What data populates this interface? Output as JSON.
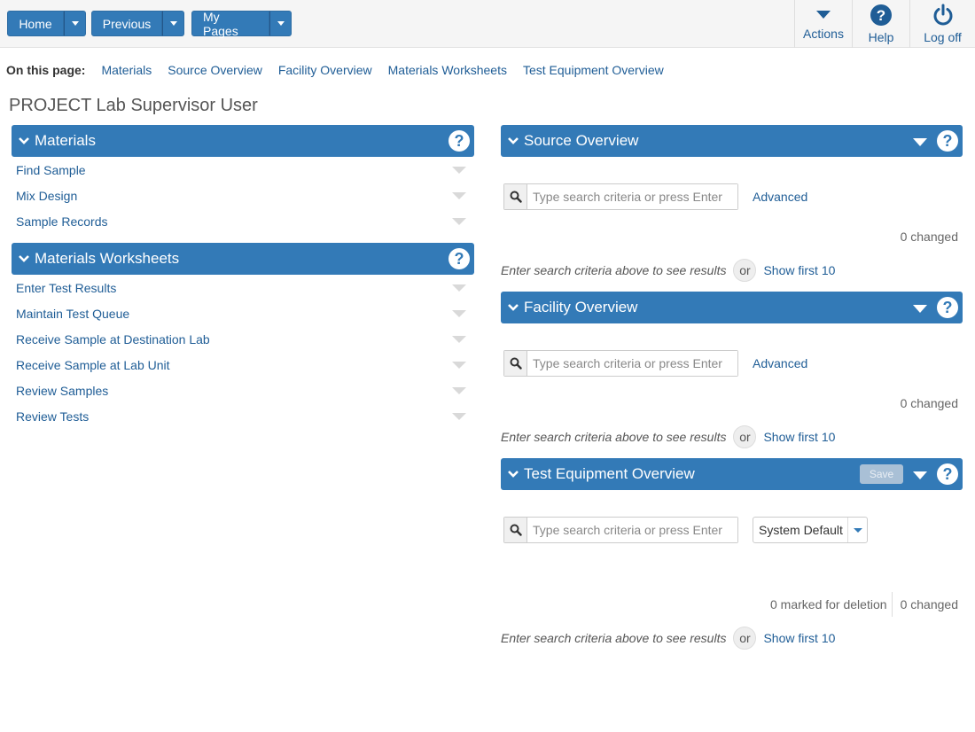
{
  "nav": {
    "home_label": "Home",
    "previous_label": "Previous",
    "mypages_label": "My Pages",
    "actions_label": "Actions",
    "help_label": "Help",
    "logoff_label": "Log off"
  },
  "onpage": {
    "lead": "On this page:",
    "links": [
      "Materials",
      "Source Overview",
      "Facility Overview",
      "Materials Worksheets",
      "Test Equipment Overview"
    ]
  },
  "page_title": "PROJECT Lab Supervisor User",
  "materials": {
    "title": "Materials",
    "items": [
      "Find Sample",
      "Mix Design",
      "Sample Records"
    ]
  },
  "worksheets": {
    "title": "Materials Worksheets",
    "items": [
      "Enter Test Results",
      "Maintain Test Queue",
      "Receive Sample at Destination Lab",
      "Receive Sample at Lab Unit",
      "Review Samples",
      "Review Tests"
    ]
  },
  "source": {
    "title": "Source Overview",
    "search_placeholder": "Type search criteria or press Enter",
    "advanced": "Advanced",
    "changed": "0 changed",
    "hint": "Enter search criteria above to see results",
    "or": "or",
    "show": "Show first 10"
  },
  "facility": {
    "title": "Facility Overview",
    "search_placeholder": "Type search criteria or press Enter",
    "advanced": "Advanced",
    "changed": "0 changed",
    "hint": "Enter search criteria above to see results",
    "or": "or",
    "show": "Show first 10"
  },
  "equipment": {
    "title": "Test Equipment Overview",
    "save": "Save",
    "search_placeholder": "Type search criteria or press Enter",
    "select_value": "System Default",
    "marked": "0 marked for deletion",
    "changed": "0 changed",
    "hint": "Enter search criteria above to see results",
    "or": "or",
    "show": "Show first 10"
  },
  "colors": {
    "primary": "#337ab7",
    "link": "#1f5d96"
  },
  "help_glyph": "?"
}
